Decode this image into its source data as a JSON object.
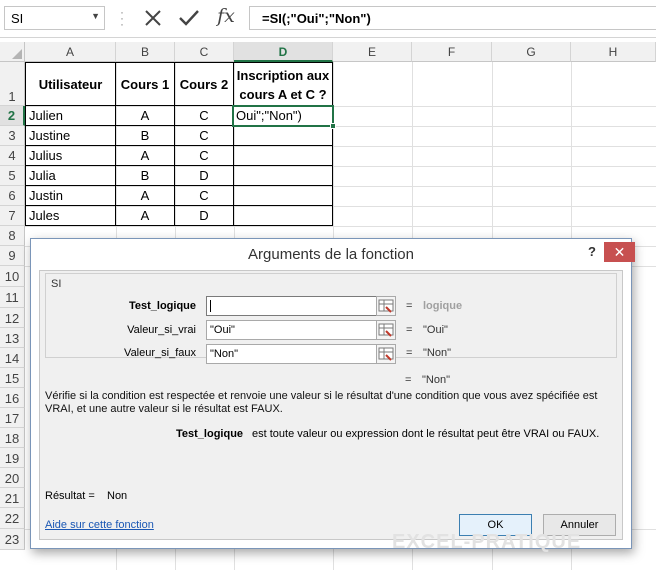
{
  "formula_bar": {
    "name_box": "SI",
    "cancel_glyph": "✕",
    "enter_glyph": "✓",
    "fx_glyph": "fx",
    "formula": "=SI(;\"Oui\";\"Non\")"
  },
  "grid": {
    "columns": [
      "A",
      "B",
      "C",
      "D",
      "E",
      "F",
      "G",
      "H"
    ],
    "rows": [
      "1",
      "2",
      "3",
      "4",
      "5",
      "6",
      "7",
      "8",
      "9",
      "10",
      "11",
      "12",
      "13",
      "14",
      "15",
      "16",
      "17",
      "18",
      "19",
      "20",
      "21",
      "22",
      "23"
    ],
    "headers": {
      "utilisateur": "Utilisateur",
      "cours1": "Cours 1",
      "cours2": "Cours 2",
      "inscription": "Inscription aux cours A et C ?"
    },
    "data": [
      {
        "name": "Julien",
        "c1": "A",
        "c2": "C"
      },
      {
        "name": "Justine",
        "c1": "B",
        "c2": "C"
      },
      {
        "name": "Julius",
        "c1": "A",
        "c2": "C"
      },
      {
        "name": "Julia",
        "c1": "B",
        "c2": "D"
      },
      {
        "name": "Justin",
        "c1": "A",
        "c2": "C"
      },
      {
        "name": "Jules",
        "c1": "A",
        "c2": "D"
      }
    ],
    "active_cell_text": "Oui\";\"Non\")"
  },
  "dialog": {
    "title": "Arguments de la fonction",
    "help": "?",
    "close": "✕",
    "function_name": "SI",
    "args": [
      {
        "label": "Test_logique",
        "value": "",
        "result": "logique"
      },
      {
        "label": "Valeur_si_vrai",
        "value": "\"Oui\"",
        "result": "\"Oui\""
      },
      {
        "label": "Valeur_si_faux",
        "value": "\"Non\"",
        "result": "\"Non\""
      }
    ],
    "equals": "=",
    "overall_result": "\"Non\"",
    "description": "Vérifie si la condition est respectée et renvoie une valeur si le résultat d'une condition que vous avez spécifiée est VRAI, et une autre valeur si le résultat est FAUX.",
    "arg_desc_name": "Test_logique",
    "arg_desc_text": "est toute valeur ou expression dont le résultat peut être VRAI ou FAUX.",
    "result_label": "Résultat =",
    "result_value": "Non",
    "help_link": "Aide sur cette fonction",
    "ok": "OK",
    "cancel": "Annuler"
  },
  "watermark": "EXCEL-PRATIQUE"
}
